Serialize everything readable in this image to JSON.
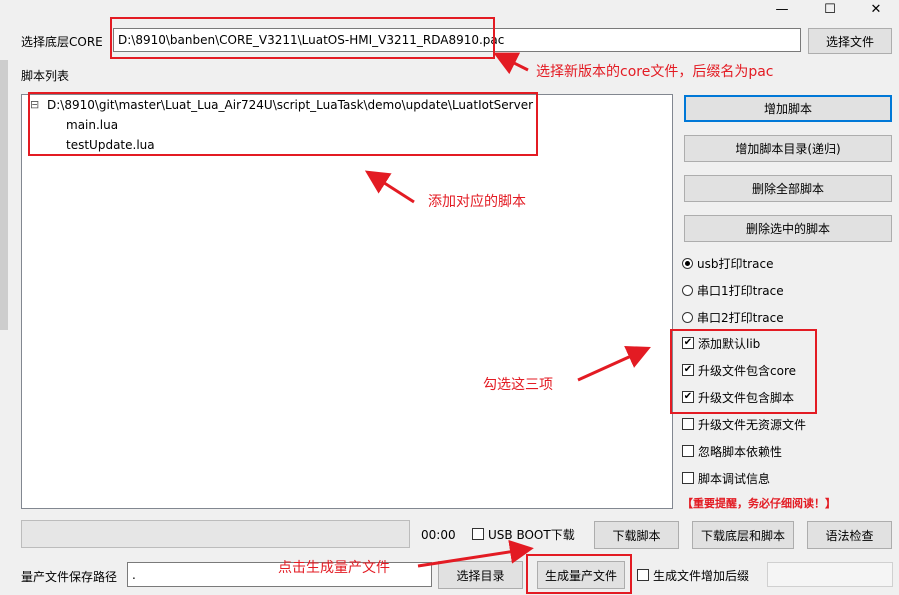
{
  "window": {
    "minimize": "—",
    "maximize": "☐",
    "close": "✕"
  },
  "core": {
    "label": "选择底层CORE",
    "path": "D:\\8910\\banben\\CORE_V3211\\LuatOS-HMI_V3211_RDA8910.pac",
    "select_button": "选择文件"
  },
  "script_list": {
    "label": "脚本列表",
    "root": "D:\\8910\\git\\master\\Luat_Lua_Air724U\\script_LuaTask\\demo\\update\\LuatIotServer",
    "expander": "⊟",
    "files": [
      "main.lua",
      "testUpdate.lua"
    ]
  },
  "side_buttons": {
    "add_script": "增加脚本",
    "add_dir": "增加脚本目录(递归)",
    "delete_all": "删除全部脚本",
    "delete_selected": "删除选中的脚本"
  },
  "trace_options": [
    {
      "label": "usb打印trace",
      "selected": true
    },
    {
      "label": "串口1打印trace",
      "selected": false
    },
    {
      "label": "串口2打印trace",
      "selected": false
    }
  ],
  "checkboxes": [
    {
      "label": "添加默认lib",
      "checked": true
    },
    {
      "label": "升级文件包含core",
      "checked": true
    },
    {
      "label": "升级文件包含脚本",
      "checked": true
    },
    {
      "label": "升级文件无资源文件",
      "checked": false
    },
    {
      "label": "忽略脚本依赖性",
      "checked": false
    },
    {
      "label": "脚本调试信息",
      "checked": false
    }
  ],
  "check_mark": "✔",
  "warning": "【重要提醒，务必仔细阅读！】",
  "bottom": {
    "timer": "00:00",
    "usb_boot_label": "USB BOOT下载",
    "download_script": "下载脚本",
    "download_core_script": "下载底层和脚本",
    "syntax_check": "语法检查"
  },
  "production": {
    "label": "量产文件保存路径",
    "path": ".",
    "select_dir": "选择目录",
    "generate": "生成量产文件",
    "append_suffix_label": "生成文件增加后缀"
  },
  "annotations": {
    "core_note": "选择新版本的core文件，后缀名为pac",
    "script_note": "添加对应的脚本",
    "check_note": "勾选这三项",
    "generate_note": "点击生成量产文件"
  },
  "colors": {
    "annotation": "#e31b23",
    "warning": "#e31b23",
    "focus": "#0078d7"
  }
}
